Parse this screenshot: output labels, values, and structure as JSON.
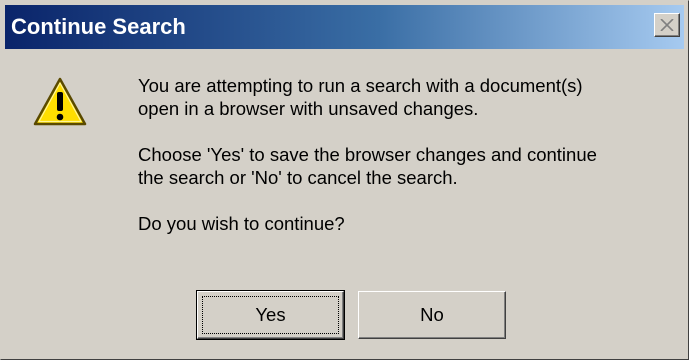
{
  "window": {
    "title": "Continue Search",
    "close_icon": "close-icon"
  },
  "icon": {
    "name": "warning-icon",
    "fill_color": "#ffde00",
    "outline_color": "#5a4a00"
  },
  "message": {
    "line1": "You are attempting to run a search with a document(s)\nopen in a browser with unsaved changes.",
    "line2": "Choose 'Yes' to save the browser changes and continue\nthe search or 'No' to cancel the search.",
    "line3": "Do you wish to continue?"
  },
  "buttons": {
    "yes_label": "Yes",
    "no_label": "No"
  },
  "colors": {
    "titlebar_start": "#0a246a",
    "titlebar_end": "#a6caf0",
    "dialog_bg": "#d4d0c8"
  }
}
